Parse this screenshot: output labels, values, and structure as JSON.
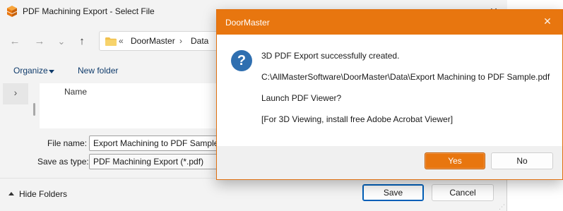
{
  "file_dialog": {
    "title": "PDF Machining Export - Select File",
    "close_glyph": "✕",
    "nav": {
      "back_glyph": "←",
      "forward_glyph": "→",
      "recent_glyph": "⌄",
      "up_glyph": "↑"
    },
    "address": {
      "overflow": "«",
      "crumbs": [
        "DoorMaster",
        "Data"
      ],
      "separator": "›"
    },
    "toolbar": {
      "organize_label": "Organize",
      "new_folder_label": "New folder"
    },
    "nav_pane": {
      "expand_glyph": "›"
    },
    "columns": {
      "name": "Name"
    },
    "file_name": {
      "label": "File name:",
      "value": "Export Machining to PDF Sample"
    },
    "save_as_type": {
      "label": "Save as type:",
      "value": "PDF Machining Export (*.pdf)"
    },
    "hide_folders_label": "Hide Folders",
    "save_label": "Save",
    "cancel_label": "Cancel"
  },
  "message_box": {
    "title": "DoorMaster",
    "close_glyph": "✕",
    "icon": "question-icon",
    "icon_glyph": "?",
    "lines": [
      "3D PDF Export successfully created.",
      "C:\\AllMasterSoftware\\DoorMaster\\Data\\Export Machining to PDF Sample.pdf",
      "Launch PDF Viewer?",
      "[For 3D Viewing, install free Adobe Acrobat Viewer]"
    ],
    "yes_label": "Yes",
    "no_label": "No"
  },
  "colors": {
    "accent_orange": "#e8760f",
    "dialog_bg": "#f3f3f3",
    "link_blue": "#0f3b6b",
    "default_button_border": "#005fb8"
  }
}
